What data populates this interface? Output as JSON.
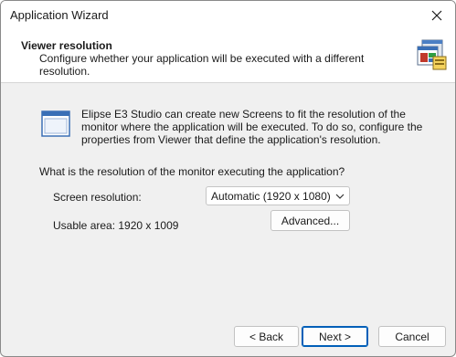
{
  "window": {
    "title": "Application Wizard"
  },
  "header": {
    "title": "Viewer resolution",
    "description": "Configure whether your application will be executed with a different resolution.",
    "icon": "wizard-screens-icon"
  },
  "main": {
    "icon": "application-window-icon",
    "intro": "Elipse E3 Studio can create new Screens to fit the resolution of the monitor where the application will be executed. To do so, configure the properties from Viewer that define the application's resolution.",
    "question": "What is the resolution of the monitor executing the application?",
    "screen_resolution_label": "Screen resolution:",
    "screen_resolution_value": "Automatic (1920 x 1080)",
    "usable_area": "Usable area: 1920 x 1009",
    "advanced_label": "Advanced..."
  },
  "footer": {
    "back_label": "< Back",
    "next_label": "Next >",
    "cancel_label": "Cancel"
  },
  "colors": {
    "accent": "#005fb8",
    "header_bg": "#ffffff",
    "body_bg": "#f0f0f0"
  }
}
